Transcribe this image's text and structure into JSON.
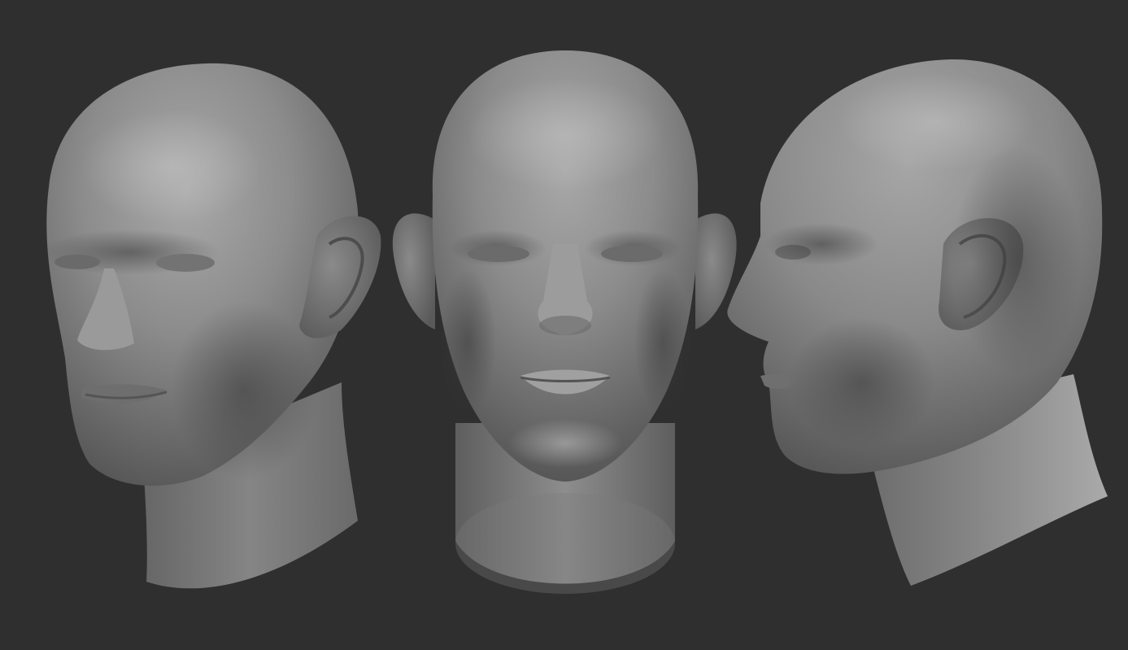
{
  "scene": {
    "background_color": "#2f2f2f",
    "material_color": "#8a8a8a",
    "views": [
      {
        "name": "three-quarter-left"
      },
      {
        "name": "front"
      },
      {
        "name": "profile-left"
      }
    ]
  }
}
